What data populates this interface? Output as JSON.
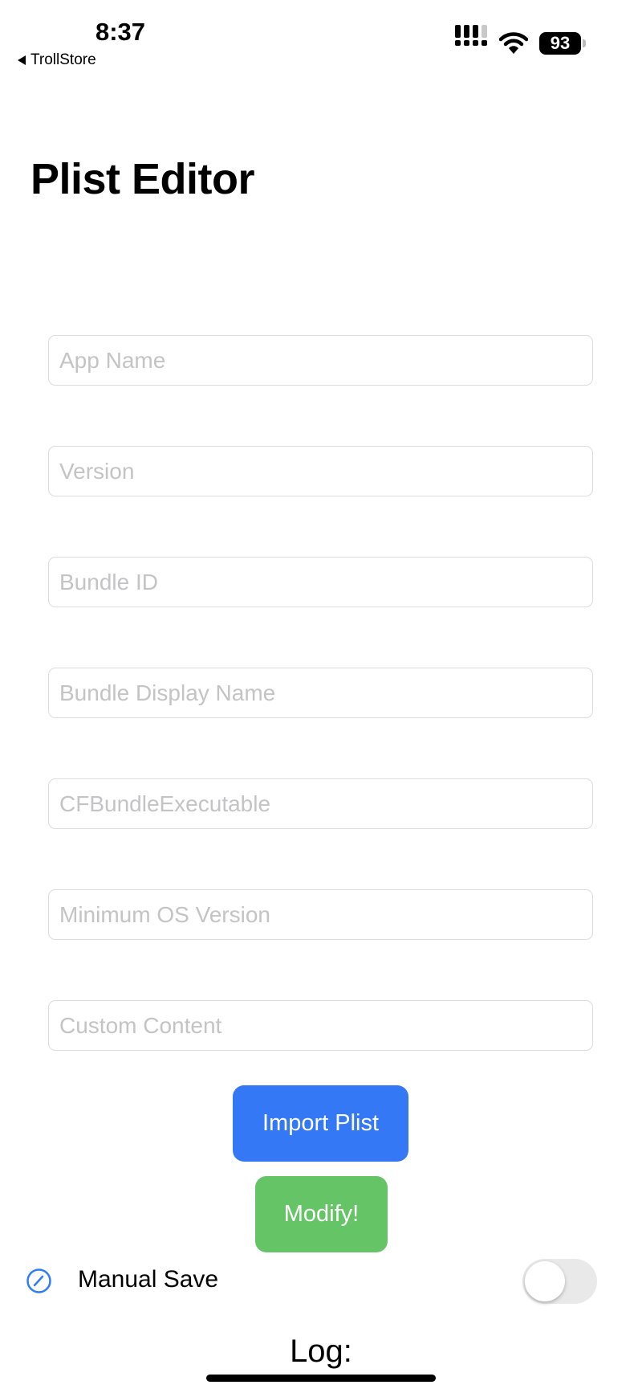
{
  "status_bar": {
    "time": "8:37",
    "back_app": "TrollStore",
    "battery": "93"
  },
  "page_title": "Plist Editor",
  "fields": [
    {
      "placeholder": "App Name",
      "value": ""
    },
    {
      "placeholder": "Version",
      "value": ""
    },
    {
      "placeholder": "Bundle ID",
      "value": ""
    },
    {
      "placeholder": "Bundle Display Name",
      "value": ""
    },
    {
      "placeholder": "CFBundleExecutable",
      "value": ""
    },
    {
      "placeholder": "Minimum OS Version",
      "value": ""
    },
    {
      "placeholder": "Custom Content",
      "value": ""
    }
  ],
  "buttons": {
    "import": "Import Plist",
    "modify": "Modify!"
  },
  "manual_save": {
    "label": "Manual Save",
    "enabled": false
  },
  "log_label": "Log:",
  "colors": {
    "import": "#3478f6",
    "modify": "#64c466",
    "accent": "#2f7cf6"
  }
}
